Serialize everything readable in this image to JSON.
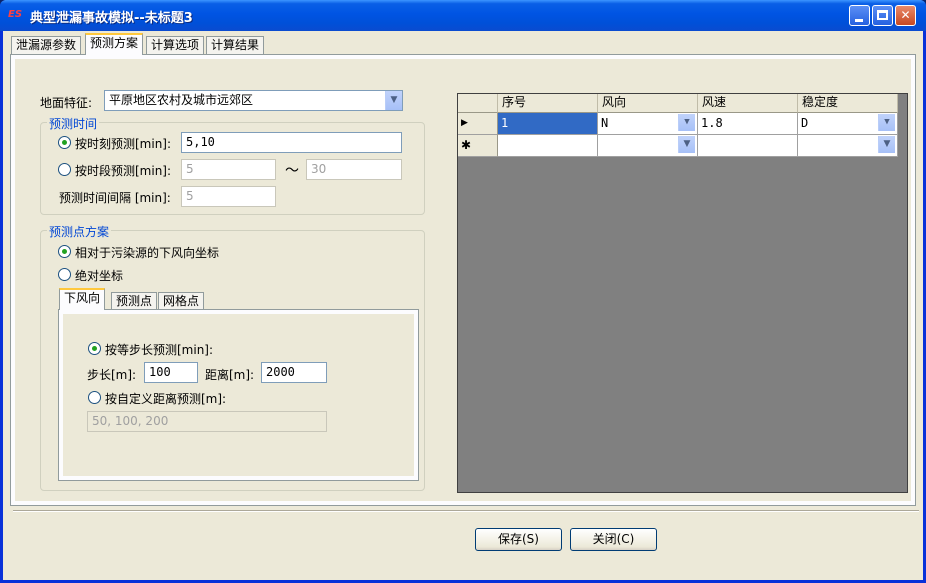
{
  "window": {
    "title": "典型泄漏事故模拟--未标题3",
    "app_icon": "ES"
  },
  "tabs": [
    {
      "label": "泄漏源参数"
    },
    {
      "label": "预测方案"
    },
    {
      "label": "计算选项"
    },
    {
      "label": "计算结果"
    }
  ],
  "terrain": {
    "label": "地面特征:",
    "value": "平原地区农村及城市远郊区"
  },
  "time_group": {
    "title": "预测时间",
    "by_moment_label": "按时刻预测[min]:",
    "by_moment_value": "5,10",
    "by_period_label": "按时段预测[min]:",
    "period_from": "5",
    "tilde": "～",
    "period_to": "30",
    "interval_label": "预测时间间隔 [min]:",
    "interval_value": "5"
  },
  "point_group": {
    "title": "预测点方案",
    "relative_label": "相对于污染源的下风向坐标",
    "absolute_label": "绝对坐标",
    "inner_tabs": [
      {
        "label": "下风向"
      },
      {
        "label": "预测点"
      },
      {
        "label": "网格点"
      }
    ],
    "equal_step_label": "按等步长预测[min]:",
    "step_label": "步长[m]:",
    "step_value": "100",
    "distance_label": "距离[m]:",
    "distance_value": "2000",
    "custom_label": "按自定义距离预测[m]:",
    "custom_value": "50, 100, 200"
  },
  "grid": {
    "columns": [
      "序号",
      "风向",
      "风速",
      "稳定度"
    ],
    "rows": [
      {
        "marker": "▶",
        "seq": "1",
        "wind_dir": "N",
        "speed": "1.8",
        "stability": "D"
      },
      {
        "marker": "✱",
        "seq": "",
        "wind_dir": "",
        "speed": "",
        "stability": ""
      }
    ]
  },
  "buttons": {
    "save": "保存(S)",
    "close": "关闭(C)"
  }
}
